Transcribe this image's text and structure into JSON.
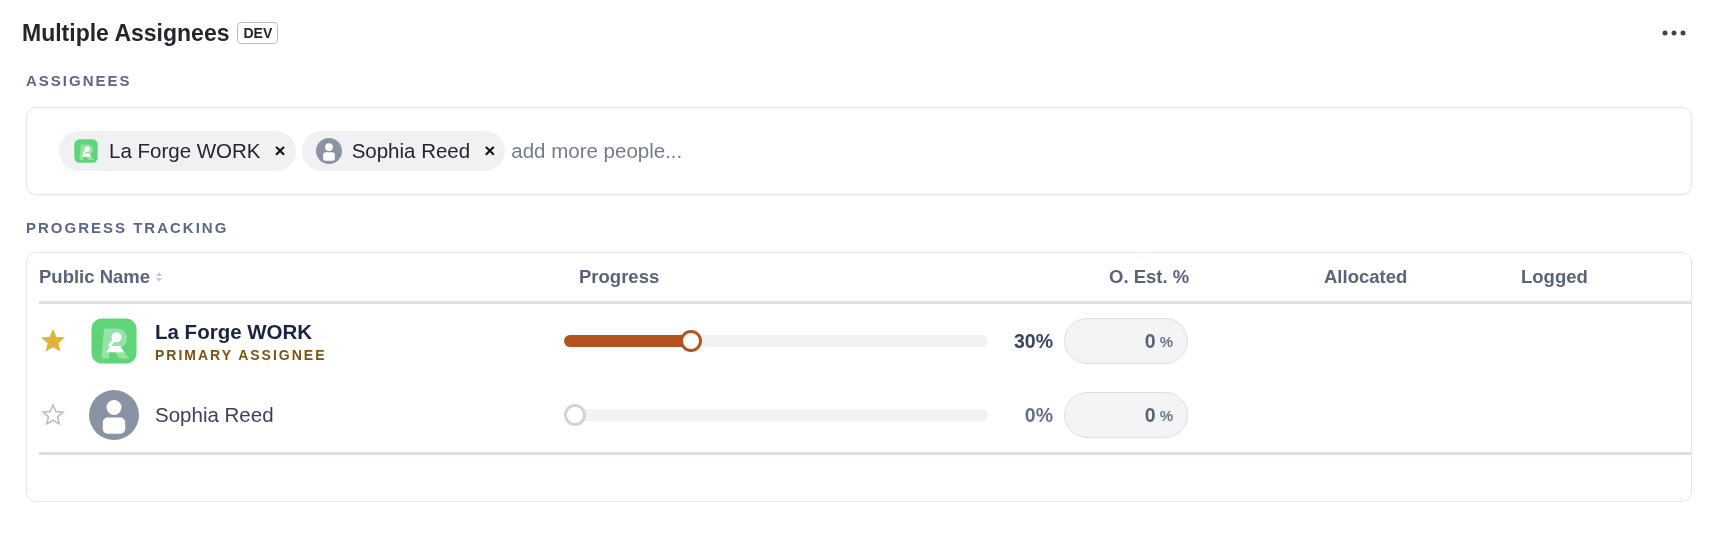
{
  "header": {
    "title": "Multiple Assignees",
    "badge": "DEV"
  },
  "assignees": {
    "label": "ASSIGNEES",
    "chips": [
      {
        "name": "La Forge WORK",
        "kind": "logo",
        "remove": "×"
      },
      {
        "name": "Sophia Reed",
        "kind": "person",
        "remove": "×"
      }
    ],
    "placeholder": "add more people..."
  },
  "progress": {
    "label": "PROGRESS TRACKING",
    "columns": [
      "Public Name",
      "Progress",
      "O. Est. %",
      "Allocated",
      "Logged"
    ],
    "rows": [
      {
        "name": "La Forge WORK",
        "kind": "logo",
        "starred": true,
        "subtitle": "PRIMARY ASSIGNEE",
        "level": 0.3,
        "percent": "30%",
        "estimate": "0",
        "estimate_unit": "%"
      },
      {
        "name": "Sophia Reed",
        "kind": "person",
        "starred": false,
        "level": 0,
        "percent": "0%",
        "estimate": "0",
        "estimate_unit": "%"
      }
    ]
  }
}
